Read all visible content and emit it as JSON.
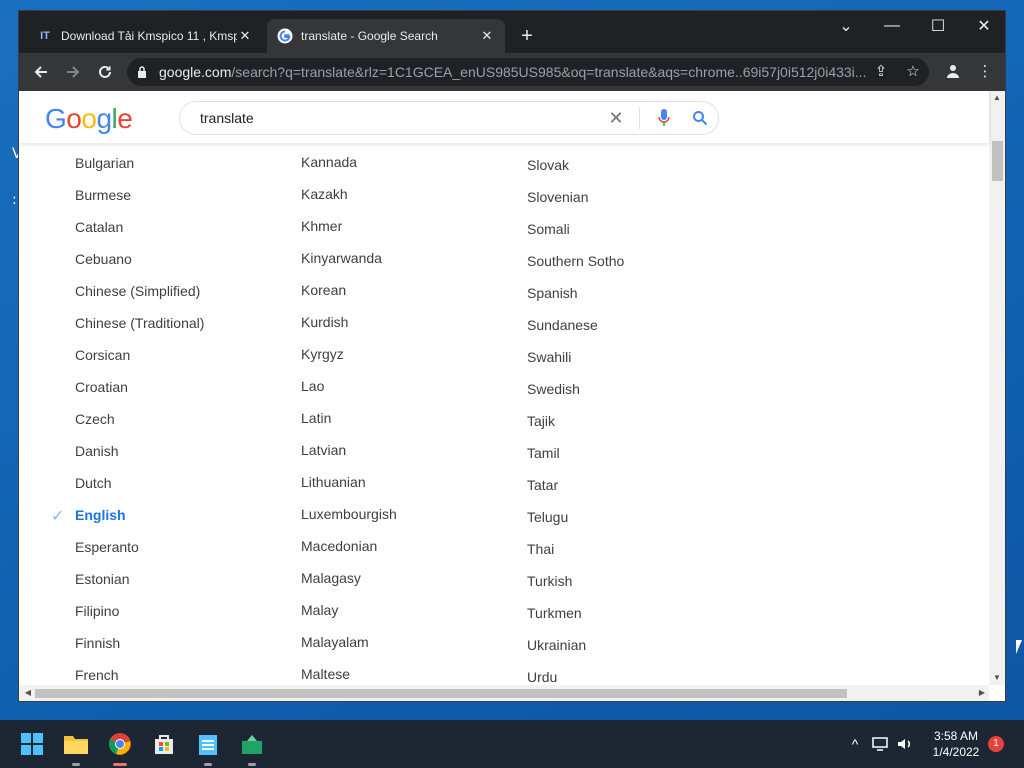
{
  "browser": {
    "tabs": [
      {
        "label": "Download Tải Kmspico 11 , Kmspi",
        "favicon": "IT",
        "active": false
      },
      {
        "label": "translate - Google Search",
        "favicon": "google-g",
        "active": true
      }
    ],
    "new_tab_label": "+",
    "url_host": "google.com",
    "url_path": "/search?q=translate&rlz=1C1GCEA_enUS985US985&oq=translate&aqs=chrome..69i57j0i512j0i433i..."
  },
  "google": {
    "logo": "Google",
    "query": "translate"
  },
  "languages": {
    "selected": "English",
    "columns": [
      [
        "Bulgarian",
        "Burmese",
        "Catalan",
        "Cebuano",
        "Chinese (Simplified)",
        "Chinese (Traditional)",
        "Corsican",
        "Croatian",
        "Czech",
        "Danish",
        "Dutch",
        "English",
        "Esperanto",
        "Estonian",
        "Filipino",
        "Finnish",
        "French"
      ],
      [
        "Kannada",
        "Kazakh",
        "Khmer",
        "Kinyarwanda",
        "Korean",
        "Kurdish",
        "Kyrgyz",
        "Lao",
        "Latin",
        "Latvian",
        "Lithuanian",
        "Luxembourgish",
        "Macedonian",
        "Malagasy",
        "Malay",
        "Malayalam",
        "Maltese"
      ],
      [
        "Slovak",
        "Slovenian",
        "Somali",
        "Southern Sotho",
        "Spanish",
        "Sundanese",
        "Swahili",
        "Swedish",
        "Tajik",
        "Tamil",
        "Tatar",
        "Telugu",
        "Thai",
        "Turkish",
        "Turkmen",
        "Ukrainian",
        "Urdu"
      ]
    ]
  },
  "taskbar": {
    "apps": [
      "start-icon",
      "file-explorer-icon",
      "chrome-icon",
      "store-icon",
      "notepad-icon",
      "app-icon"
    ],
    "time": "3:58 AM",
    "date": "1/4/2022",
    "notification_count": "1"
  },
  "colors": {
    "accent": "#1a73e8",
    "desktop": "#1565b0",
    "chrome_dark": "#202124",
    "taskbar": "#1c2733"
  }
}
